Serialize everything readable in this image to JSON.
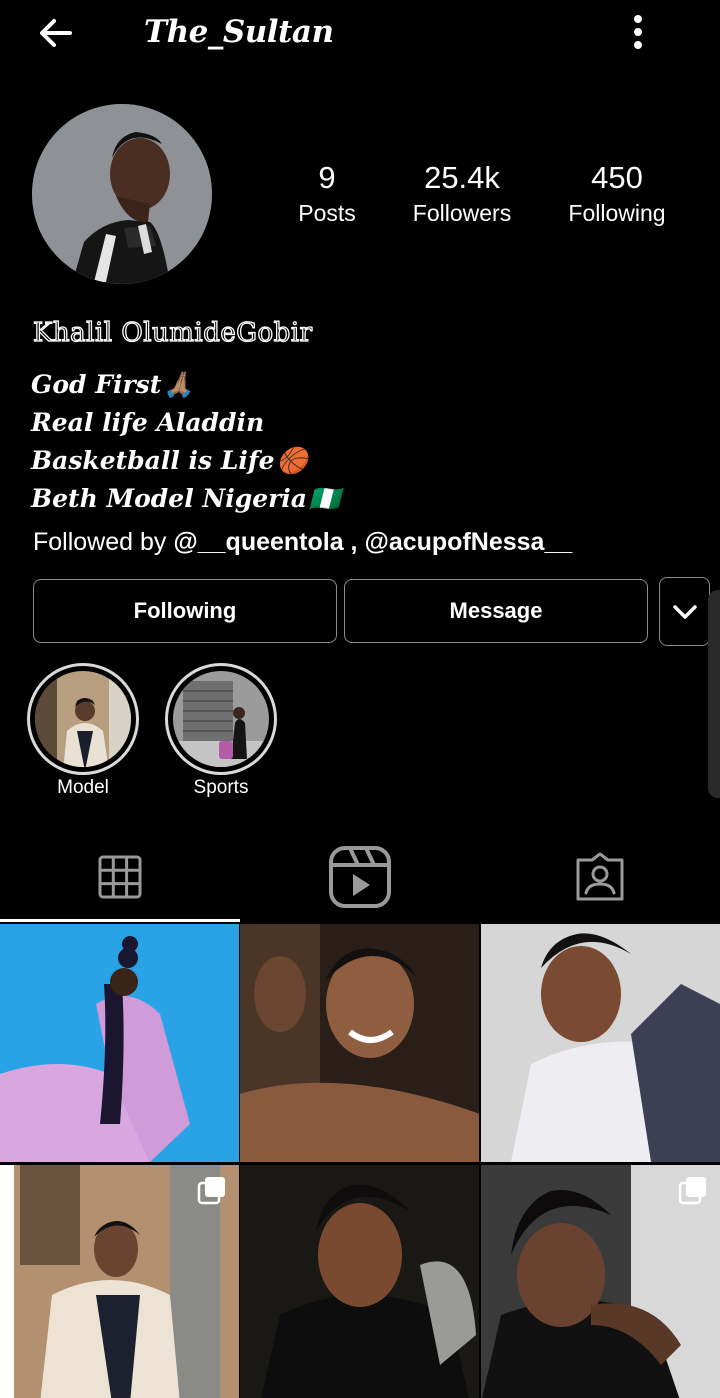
{
  "header": {
    "username": "The_Sultan",
    "back_icon": "back-arrow-icon",
    "more_icon": "more-vertical-icon"
  },
  "stats": [
    {
      "value": "9",
      "label": "Posts"
    },
    {
      "value": "25.4k",
      "label": "Followers"
    },
    {
      "value": "450",
      "label": "Following"
    }
  ],
  "profile": {
    "full_name": "Khalil OlumideGobir",
    "bio": [
      {
        "text": "God First",
        "emoji": "🙏🏽"
      },
      {
        "text": "Real life Aladdin",
        "emoji": ""
      },
      {
        "text": "Basketball is Life",
        "emoji": "🏀"
      },
      {
        "text": "Beth Model Nigeria",
        "emoji": "🇳🇬"
      }
    ],
    "followed_by_prefix": "Followed by ",
    "followed_by_users": "@__queentola , @acupofNessa__"
  },
  "actions": {
    "following_label": "Following",
    "message_label": "Message",
    "more_icon": "chevron-down-icon"
  },
  "highlights": [
    {
      "label": "Model"
    },
    {
      "label": "Sports"
    }
  ],
  "tabs": [
    {
      "icon": "grid-icon",
      "active": true
    },
    {
      "icon": "reels-icon",
      "active": false
    },
    {
      "icon": "tagged-icon",
      "active": false
    }
  ],
  "colors": {
    "background": "#000000",
    "text": "#ffffff",
    "button_border": "#8b8b8b",
    "highlight_ring": "#d9d9d9"
  }
}
